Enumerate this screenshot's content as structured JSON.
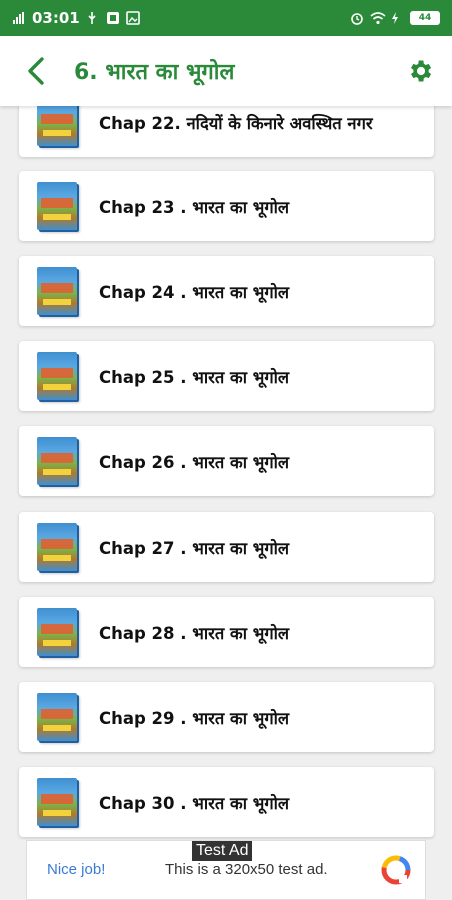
{
  "statusbar": {
    "time": "03:01",
    "battery": "44"
  },
  "appbar": {
    "title": "6. भारत का भूगोल"
  },
  "list": {
    "items": [
      {
        "label": "Chap 22. नदियों के किनारे अवस्थित नगर"
      },
      {
        "label": "Chap 23 . भारत का भूगोल"
      },
      {
        "label": "Chap 24 . भारत का भूगोल"
      },
      {
        "label": "Chap 25 . भारत का भूगोल"
      },
      {
        "label": "Chap 26 . भारत का भूगोल"
      },
      {
        "label": "Chap 27 . भारत का भूगोल"
      },
      {
        "label": "Chap 28 . भारत का भूगोल"
      },
      {
        "label": "Chap 29 . भारत का भूगोल"
      },
      {
        "label": "Chap 30 . भारत का भूगोल"
      }
    ]
  },
  "ad": {
    "tag": "Test Ad",
    "nice": "Nice job!",
    "text": "This is a 320x50 test ad."
  },
  "colors": {
    "primary": "#2a8a3a",
    "link": "#3a7bd5"
  }
}
